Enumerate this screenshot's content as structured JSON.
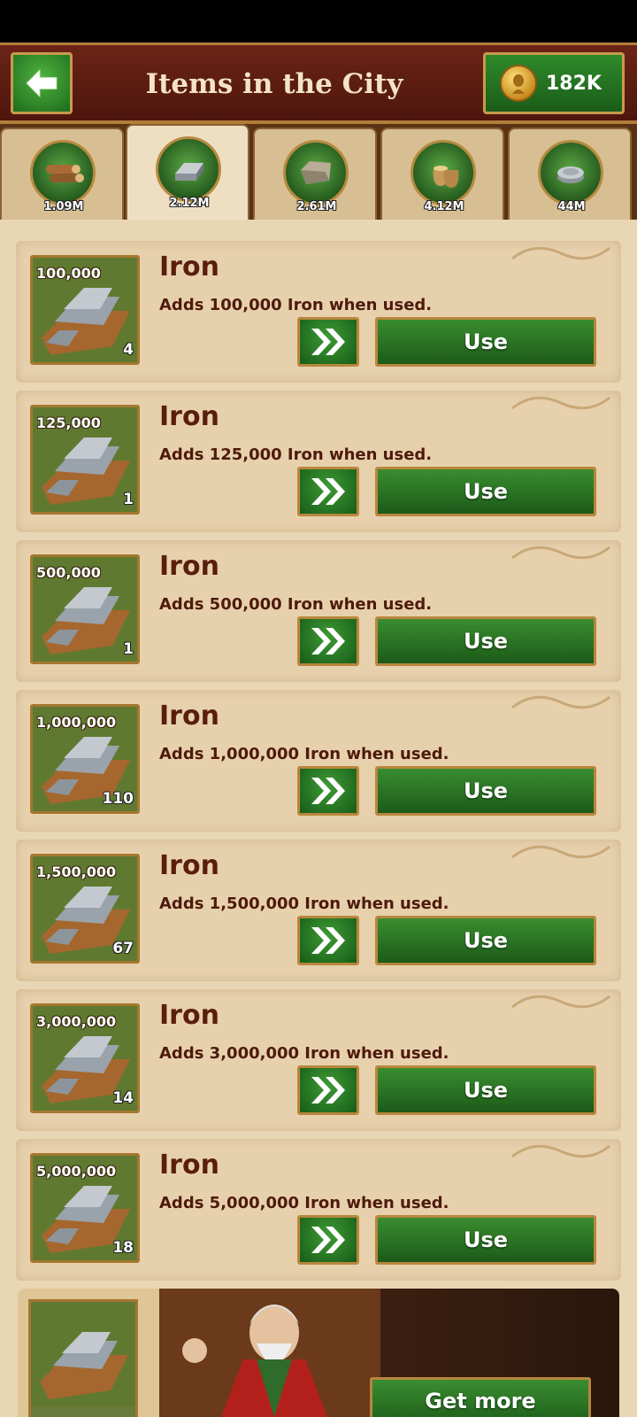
{
  "header": {
    "title": "Items in the City",
    "gold": "182K"
  },
  "tabs": [
    {
      "name": "wood",
      "value": "1.09M",
      "active": false
    },
    {
      "name": "iron",
      "value": "2.12M",
      "active": true
    },
    {
      "name": "stone",
      "value": "2.61M",
      "active": false
    },
    {
      "name": "food",
      "value": "4.12M",
      "active": false
    },
    {
      "name": "silver",
      "value": "44M",
      "active": false
    }
  ],
  "items": [
    {
      "title": "Iron",
      "amount": "100,000",
      "description": "Adds 100,000 Iron when used.",
      "count": "4",
      "use_label": "Use"
    },
    {
      "title": "Iron",
      "amount": "125,000",
      "description": "Adds 125,000 Iron when used.",
      "count": "1",
      "use_label": "Use"
    },
    {
      "title": "Iron",
      "amount": "500,000",
      "description": "Adds 500,000 Iron when used.",
      "count": "1",
      "use_label": "Use"
    },
    {
      "title": "Iron",
      "amount": "1,000,000",
      "description": "Adds 1,000,000 Iron when used.",
      "count": "110",
      "use_label": "Use"
    },
    {
      "title": "Iron",
      "amount": "1,500,000",
      "description": "Adds 1,500,000 Iron when used.",
      "count": "67",
      "use_label": "Use"
    },
    {
      "title": "Iron",
      "amount": "3,000,000",
      "description": "Adds 3,000,000 Iron when used.",
      "count": "14",
      "use_label": "Use"
    },
    {
      "title": "Iron",
      "amount": "5,000,000",
      "description": "Adds 5,000,000 Iron when used.",
      "count": "18",
      "use_label": "Use"
    }
  ],
  "promo": {
    "button_label": "Get more"
  },
  "icons": {
    "back": "arrow-left-icon",
    "gold": "gold-coin-icon",
    "fast": "double-chevron-icon",
    "tabs": [
      "wood-logs-icon",
      "iron-ingot-icon",
      "stone-block-icon",
      "grain-sack-icon",
      "silver-coins-icon"
    ]
  },
  "colors": {
    "header": "#5a1a0f",
    "button_green": "#2f7d2a",
    "border_gold": "#b8863c",
    "parchment": "#e9d6b4",
    "text_brown": "#5a1e0e"
  }
}
